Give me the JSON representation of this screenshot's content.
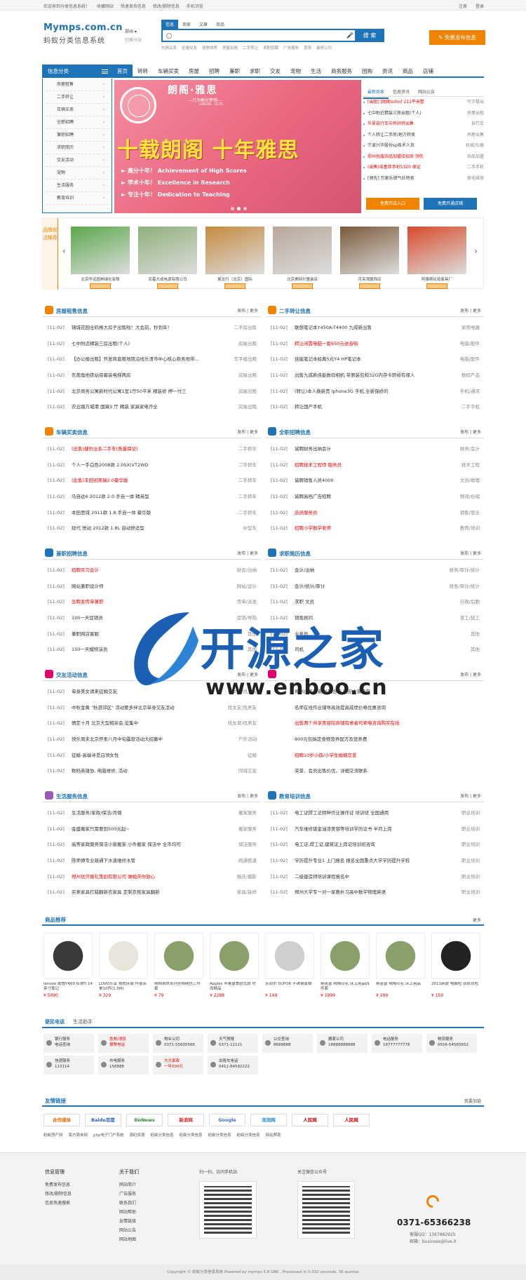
{
  "topbar": {
    "welcome": "欢迎来到分类信息系统！",
    "links_left": [
      "收藏网站",
      "快速发布信息",
      "修改/删除信息",
      "手机浏览"
    ],
    "login": "登录",
    "register": "注册"
  },
  "logo": {
    "main": "Mymps.com.cn",
    "sub": "蚂蚁分类信息系统"
  },
  "city": {
    "name": "郑州",
    "switch": "切换分站"
  },
  "search": {
    "tabs": [
      "信息",
      "商家",
      "文章",
      "商品"
    ],
    "button": "搜 索",
    "hot": [
      "车辆买卖",
      "征婚交友",
      "宠物领养",
      "房屋出租",
      "二手转让",
      "求职招聘",
      "广告服务",
      "宽带",
      "装修公司"
    ]
  },
  "post_button": "免费发布信息",
  "nav": {
    "category_title": "信息分类",
    "items": [
      "首页",
      "转转",
      "车辆买卖",
      "房屋",
      "招聘",
      "兼职",
      "求职",
      "交友",
      "宠物",
      "生活",
      "商务服务",
      "团购",
      "资讯",
      "商品",
      "店铺"
    ]
  },
  "categories": [
    "房屋租售",
    "二手转让",
    "车辆买卖",
    "全职招聘",
    "兼职招聘",
    "求职简历",
    "交友活动",
    "宠物",
    "生活服务",
    "教育培训"
  ],
  "banner": {
    "title": "朗阁·雅思",
    "subtitle": "—只为高分梦想—",
    "brand": "LONGRE · IELTS",
    "headline": "十载朗阁 十年雅思",
    "slogans": [
      "► 高分十年！ Achievement of High Scores",
      "► 学术十年！ Excellence in Research",
      "► 专注十年！ Dedication to Teaching"
    ]
  },
  "notice": {
    "tabs": [
      "最新商家",
      "信息资讯",
      "网站公告"
    ],
    "rows": [
      {
        "t": "[出租] [朗阁soho] 211平米整",
        "c": "写字楼出",
        "red": true
      },
      {
        "t": "七中附近精装三房出租(个人)",
        "c": "房屋出租",
        "red": false
      },
      {
        "t": "华夏自行车中央好转出售",
        "c": "自行车",
        "red": true
      },
      {
        "t": "个人转让二手房/地方转卖",
        "c": "房屋出售",
        "red": false
      },
      {
        "t": "宁波兴华股份sp技术人员",
        "c": "机械/仪器",
        "red": false
      },
      {
        "t": "郑州悦鑫饰品加盟店招商 领先",
        "c": "饰品加盟",
        "red": true
      },
      {
        "t": "(出售)诺基亚手机5320 保证",
        "c": "二手手机",
        "red": true
      },
      {
        "t": "[领先] 万家乐燃气灶特卖 ",
        "c": "家电维修",
        "red": false
      }
    ],
    "btn_shop": "免费开店入口",
    "btn_post": "免费开通店铺"
  },
  "recommend": {
    "label": "品牌前沿推荐",
    "items": [
      "北京华远园林绿化有限",
      "宏基大成电源有限公司",
      "紫龙行（北京）国际",
      "北京美特尔童装店",
      "月亮湾服饰店",
      "阿泰斯化妆家具厂"
    ]
  },
  "panels": [
    {
      "title": "房屋租售信息",
      "more": "发布 | 更多",
      "icon": "#f08300",
      "rows": [
        {
          "d": "[11-02]",
          "t": "锦城花园全码格大房子出售啦！大会前，秒到年！",
          "c": "二手房出售",
          "red": false
        },
        {
          "d": "[11-02]",
          "t": "七中附近精装三房出租(个人)",
          "c": "房屋出租",
          "red": false
        },
        {
          "d": "[11-02]",
          "t": "【办公楼出租】开发商直租地铁沿线乐清市中心核心商务地带...",
          "c": "写字楼出租",
          "red": false
        },
        {
          "d": "[11-02]",
          "t": "东南角地铁站旁豪装电梯两房",
          "c": "房屋出租",
          "red": false
        },
        {
          "d": "[11-02]",
          "t": "北京商务公寓新时代公寓1室1厅50平米 精装修 押一付三",
          "c": "房屋出租",
          "red": false
        },
        {
          "d": "[11-02]",
          "t": "农业路万城港 国貿3 厅 精装 家具家电齐全",
          "c": "房屋出租",
          "red": false
        }
      ]
    },
    {
      "title": "二手转让信息",
      "more": "发布 | 更多",
      "icon": "#f08300",
      "rows": [
        {
          "d": "[11-02]",
          "t": "联想笔记本Y450A-T4400 九成新出售",
          "c": "家用电器",
          "red": false
        },
        {
          "d": "[11-02]",
          "t": "转让闲置电脑一套650元送音响",
          "c": "电脑/配件",
          "red": true
        },
        {
          "d": "[11-02]",
          "t": "佳能笔记本经典5元Y4 HP笔记本",
          "c": "电脑/配件",
          "red": false
        },
        {
          "d": "[11-02]",
          "t": "出售九成新佳能数码相机 带原装包和32G内存卡转给有缘人",
          "c": "数码产品",
          "red": false
        },
        {
          "d": "[11-02]",
          "t": "(转让)本人换新贵 iphone3G 手机,全新保修的",
          "c": "手机/通讯",
          "red": false
        },
        {
          "d": "[11-02]",
          "t": "转让国产手机",
          "c": "二手手机",
          "red": false
        }
      ]
    },
    {
      "title": "车辆买卖信息",
      "more": "发布 | 更多",
      "icon": "#f08300",
      "rows": [
        {
          "d": "[11-02]",
          "t": "(出售)捷豹全系二手车(质量保证)",
          "c": "二手轿车",
          "red": true
        },
        {
          "d": "[11-02]",
          "t": "个人一手白色2008款 2.0SX(VT2WD",
          "c": "二手轿车",
          "red": false
        },
        {
          "d": "[11-02]",
          "t": "(出售)丰田凯美瑞2.0豪华版",
          "c": "二手轿车",
          "red": true
        },
        {
          "d": "[11-02]",
          "t": "马自达6 2012款 2.0 手自一体 精英型",
          "c": "二手轿车",
          "red": false
        },
        {
          "d": "[11-02]",
          "t": "本田思域 2011款 1.8 手自一体 豪华版",
          "c": "二手轿车",
          "red": false
        },
        {
          "d": "[11-02]",
          "t": "现代 悦动 2012款 1.8L 自动舒适型",
          "c": "中型车",
          "red": false
        }
      ]
    },
    {
      "title": "全职招聘信息",
      "more": "发布 | 更多",
      "icon": "#1f73b7",
      "rows": [
        {
          "d": "[11-02]",
          "t": "诚聘财务出纳会计",
          "c": "财务/会计",
          "red": false
        },
        {
          "d": "[11-02]",
          "t": "招聘技术工程师 服务员",
          "c": "技术工程",
          "red": true
        },
        {
          "d": "[11-02]",
          "t": "诚聘销售人员4000",
          "c": "文员/助理",
          "red": false
        },
        {
          "d": "[11-02]",
          "t": "诚聘高档广告招聘",
          "c": "物流/仓储",
          "red": false
        },
        {
          "d": "[11-02]",
          "t": "店员服务员",
          "c": "销售/营业",
          "red": true
        },
        {
          "d": "[11-02]",
          "t": "招聘小学数学老师",
          "c": "教育/培训",
          "red": true
        }
      ]
    },
    {
      "title": "兼职招聘信息",
      "more": "发布 | 更多",
      "icon": "#1f73b7",
      "rows": [
        {
          "d": "[11-02]",
          "t": "招聘实习会计",
          "c": "财会/出纳",
          "red": true
        },
        {
          "d": "[11-02]",
          "t": "网站兼职设计师",
          "c": "网站/设计",
          "red": false
        },
        {
          "d": "[11-02]",
          "t": "急聘发传单兼职 ",
          "c": "传单/派发",
          "red": true
        },
        {
          "d": "[11-02]",
          "t": "100一天促销员",
          "c": "促销/导购",
          "red": false
        },
        {
          "d": "[11-02]",
          "t": "兼职网店客服",
          "c": "其他",
          "red": false
        },
        {
          "d": "[11-02]",
          "t": "150一天模特演员",
          "c": "其他",
          "red": false
        }
      ]
    },
    {
      "title": "求职简历信息",
      "more": "发布 | 更多",
      "icon": "#1f73b7",
      "rows": [
        {
          "d": "[11-02]",
          "t": "会计/出纳",
          "c": "财务/审计/统计",
          "red": false
        },
        {
          "d": "[11-02]",
          "t": "会计/统计/审计",
          "c": "财务/审计/统计",
          "red": false
        },
        {
          "d": "[11-02]",
          "t": "求职 文员",
          "c": "行政/后勤",
          "red": false
        },
        {
          "d": "[11-02]",
          "t": "销售顾问",
          "c": "普工/技工",
          "red": false
        },
        {
          "d": "[11-02]",
          "t": "业务员",
          "c": "其他",
          "red": false
        },
        {
          "d": "[11-02]",
          "t": "司机",
          "c": "其他",
          "red": false
        }
      ]
    },
    {
      "title": "交友活动信息",
      "more": "发布 | 更多",
      "icon": "#e0006e",
      "rows": [
        {
          "d": "[11-02]",
          "t": "单身美女请来征婚交友",
          "c": "找女友/找男友",
          "red": false
        },
        {
          "d": "[11-02]",
          "t": "中秋金黄 \"秋游郊区\" 活动要多伴北京单身交友活动",
          "c": "找女友/找男友",
          "red": false
        },
        {
          "d": "[11-02]",
          "t": "情定十月 北京大型相亲会,征集中",
          "c": "找女友/找男友",
          "red": false
        },
        {
          "d": "[11-02]",
          "t": "快乐周末北京怀柔八月中旬露营活动大招募中",
          "c": "户外活动",
          "red": false
        },
        {
          "d": "[11-02]",
          "t": "征婚-高端寻觅白领女性",
          "c": "征婚",
          "red": false
        },
        {
          "d": "[11-02]",
          "t": "数码英雄协, 电脑维修, 活动",
          "c": "同城交友",
          "red": false
        }
      ]
    },
    {
      "title": "",
      "more": "发布 | 更多",
      "icon": "#e0006e",
      "rows": [
        {
          "d": "",
          "t": "郑州出售两家 长期合作 欢迎大家来电",
          "c": "",
          "red": false
        },
        {
          "d": "",
          "t": "名师在线作业辅导高效提高成绩价格优惠咨询",
          "c": "",
          "red": false
        },
        {
          "d": "",
          "t": "出售两个共享美容院商铺有意者可来电咨询购买在线",
          "c": "",
          "red": true
        },
        {
          "d": "",
          "t": "800元包搞定食物营养配方及营养费",
          "c": "",
          "red": false
        },
        {
          "d": "",
          "t": "招聘10岁小孩/小学生婚姻恋爱",
          "c": "",
          "red": true
        },
        {
          "d": "",
          "t": "荣誉、会员出售价优，详细交流联系",
          "c": "",
          "red": false
        }
      ]
    },
    {
      "title": "生活服务信息",
      "more": "发布 | 更多",
      "icon": "#9b59b6",
      "rows": [
        {
          "d": "[11-02]",
          "t": "生活服务/家政/保洁/月嫂",
          "c": "搬家服务",
          "red": false
        },
        {
          "d": "[11-02]",
          "t": "金盛搬家只需要到500元起~",
          "c": "搬家服务",
          "red": false
        },
        {
          "d": "[11-02]",
          "t": "高等家政服务保洁小家搬家 小件搬家 保洁中 全市均可",
          "c": "保洁服务",
          "red": false
        },
        {
          "d": "[11-02]",
          "t": "陈师傅专业疏通下水道维修水管",
          "c": "疏通管道",
          "red": false
        },
        {
          "d": "[11-02]",
          "t": "郑州优贝婚礼策划有限公司 做婚庆你放心",
          "c": "婚庆/摄影",
          "red": true
        },
        {
          "d": "[11-02]",
          "t": "买来家具打蜡翻新衣家具 定制衣柜家具翻新",
          "c": "家具/装修",
          "red": false
        }
      ]
    },
    {
      "title": "教育培训信息",
      "more": "发布 | 更多",
      "icon": "#1f73b7",
      "rows": [
        {
          "d": "[11-02]",
          "t": "电工证焊工证特种作业操作证 培训班 全国通用",
          "c": "职业培训",
          "red": false
        },
        {
          "d": "[11-02]",
          "t": "汽车维修钣金油漆美容等培训学历证书 半月上岗",
          "c": "职业培训",
          "red": false
        },
        {
          "d": "[11-02]",
          "t": "电工证,焊工证,建筑证上岗证培训班咨询",
          "c": "职业培训",
          "red": false
        },
        {
          "d": "[11-02]",
          "t": "学历提升专业1 上门报名 报名全国重点大学学历提升学校",
          "c": "职业培训",
          "red": false
        },
        {
          "d": "[11-02]",
          "t": "二级建造师培训课程报名中",
          "c": "职业培训",
          "red": false
        },
        {
          "d": "[11-02]",
          "t": "郑州大学专一对一家教补习高中数学物理英语",
          "c": "职业培训",
          "red": false
        }
      ]
    }
  ],
  "goods": {
    "title": "商品推荐",
    "more": "更多",
    "items": [
      {
        "n": "lenovo 联想Y460 N-BFI 14英寸笔记",
        "p": "¥ 5090"
      },
      {
        "n": "LOVO乐享 抱枕床套 件套床单10件(1.5M)",
        "p": "¥ 329"
      },
      {
        "n": "纯棉自然系列全棉纯色三件套",
        "p": "¥ 79"
      },
      {
        "n": "Apples 苹果夏季欧式款 时尚精品",
        "p": "¥ 2288"
      },
      {
        "n": "苏泊尔 SUPOR 不锈钢蒸锅",
        "p": "¥ 149"
      },
      {
        "n": "斯诺普 纯棉印花 床上用品四件套",
        "p": "¥ 1999"
      },
      {
        "n": "斯诺普 纯棉印花 床上用品",
        "p": "¥ 299"
      },
      {
        "n": "2011新款 电脑包 双肩背包",
        "p": "¥ 150"
      }
    ]
  },
  "convenience": {
    "tabs": [
      "便民电话",
      "生活助手"
    ],
    "cards": [
      {
        "a": "银行服务",
        "b": "电话查询"
      },
      {
        "a": "急救/消防",
        "b": "报警电话"
      },
      {
        "a": "物业公司",
        "b": "0371-55605566"
      },
      {
        "a": "天气预报",
        "b": "0371-12121"
      },
      {
        "a": "公交查询",
        "b": "8688888"
      },
      {
        "a": "搬家公司",
        "b": "18888888888"
      },
      {
        "a": "电话服务",
        "b": "18777777778"
      },
      {
        "a": "物流服务",
        "b": "0556-54565652"
      },
      {
        "a": "快递服务",
        "b": "113114"
      },
      {
        "a": "市电服务",
        "b": "156888"
      },
      {
        "a": "大大家政",
        "b": "一年500元"
      },
      {
        "a": "出租车电话",
        "b": "0411-84592222"
      }
    ]
  },
  "links": {
    "title": "友情链接",
    "more": "我要加链",
    "logos": [
      "合作媒体",
      "Baidu百度",
      "DoNews",
      "新浪网",
      "Google",
      "泡泡网",
      "人民网",
      "人民网"
    ],
    "text": [
      "蚂蚁房产网",
      "南方周末网",
      "php电子门户系统",
      "源码资源",
      "蚂蚁分类信息",
      "蚂蚁分类信息",
      "蚂蚁分类信息",
      "蚂蚁分类信息",
      "网站帮助"
    ]
  },
  "footer": {
    "col1": {
      "title": "信息管理",
      "items": [
        "免费发布信息",
        "修改/删除信息",
        "信息快速搜索"
      ]
    },
    "col2": {
      "title": "关于我们",
      "items": [
        "网站简介",
        "广告服务",
        "联系我们",
        "网站帮助",
        "友情链接",
        "网站公告",
        "网站地图"
      ]
    },
    "qr1": "扫一扫，访问手机站",
    "qr2": "关注微信公众号",
    "phone": "0371-65366238",
    "qq": "客服QQ：1367882925",
    "email": "邮箱：business@live.it"
  },
  "copyright": "Copyright © 蚂蚁分类信息系统 Powered by mymps 5.8 GBK , Processed in 0.032 seconds, 36 queries",
  "watermark": {
    "cn": "开源之家",
    "url": "www.enboo.cn"
  }
}
